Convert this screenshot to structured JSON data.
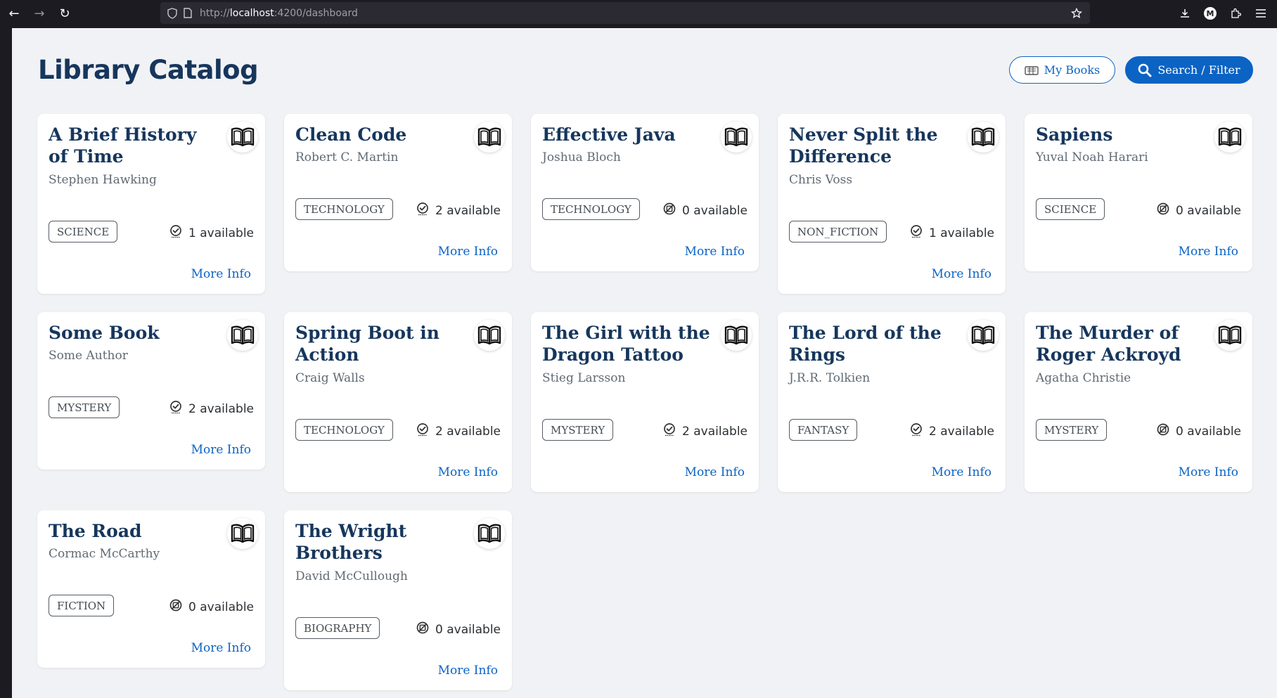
{
  "browser": {
    "url_scheme": "http://",
    "url_host": "localhost",
    "url_rest": ":4200/dashboard",
    "account_initial": "M"
  },
  "page": {
    "title": "Library Catalog",
    "my_books_label": "My Books",
    "search_label": "Search / Filter"
  },
  "books": [
    {
      "title": "A Brief History of Time",
      "author": "Stephen Hawking",
      "genre": "SCIENCE",
      "available": "1 available",
      "in_stock": true,
      "more": "More Info"
    },
    {
      "title": "Clean Code",
      "author": "Robert C. Martin",
      "genre": "TECHNOLOGY",
      "available": "2 available",
      "in_stock": true,
      "more": "More Info"
    },
    {
      "title": "Effective Java",
      "author": "Joshua Bloch",
      "genre": "TECHNOLOGY",
      "available": "0 available",
      "in_stock": false,
      "more": "More Info"
    },
    {
      "title": "Never Split the Difference",
      "author": "Chris Voss",
      "genre": "NON_FICTION",
      "available": "1 available",
      "in_stock": true,
      "more": "More Info"
    },
    {
      "title": "Sapiens",
      "author": "Yuval Noah Harari",
      "genre": "SCIENCE",
      "available": "0 available",
      "in_stock": false,
      "more": "More Info"
    },
    {
      "title": "Some Book",
      "author": "Some Author",
      "genre": "MYSTERY",
      "available": "2 available",
      "in_stock": true,
      "more": "More Info"
    },
    {
      "title": "Spring Boot in Action",
      "author": "Craig Walls",
      "genre": "TECHNOLOGY",
      "available": "2 available",
      "in_stock": true,
      "more": "More Info"
    },
    {
      "title": "The Girl with the Dragon Tattoo",
      "author": "Stieg Larsson",
      "genre": "MYSTERY",
      "available": "2 available",
      "in_stock": true,
      "more": "More Info"
    },
    {
      "title": "The Lord of the Rings",
      "author": "J.R.R. Tolkien",
      "genre": "FANTASY",
      "available": "2 available",
      "in_stock": true,
      "more": "More Info"
    },
    {
      "title": "The Murder of Roger Ackroyd",
      "author": "Agatha Christie",
      "genre": "MYSTERY",
      "available": "0 available",
      "in_stock": false,
      "more": "More Info"
    },
    {
      "title": "The Road",
      "author": "Cormac McCarthy",
      "genre": "FICTION",
      "available": "0 available",
      "in_stock": false,
      "more": "More Info"
    },
    {
      "title": "The Wright Brothers",
      "author": "David McCullough",
      "genre": "BIOGRAPHY",
      "available": "0 available",
      "in_stock": false,
      "more": "More Info"
    }
  ],
  "colors": {
    "title": "#16365c",
    "accent": "#0b63c4",
    "background": "#f1f2f5"
  }
}
